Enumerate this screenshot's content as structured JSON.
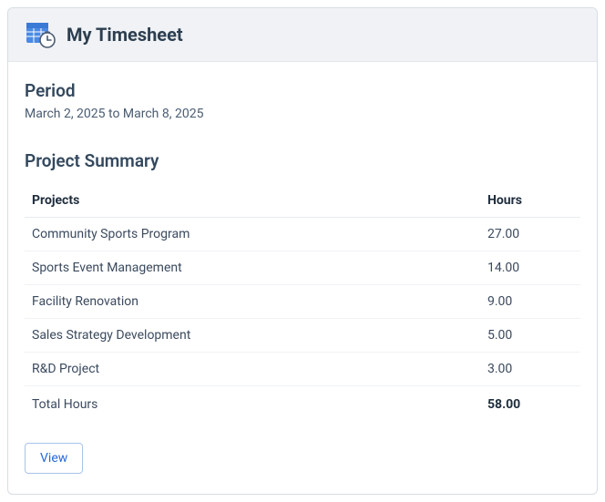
{
  "header": {
    "title": "My Timesheet"
  },
  "period": {
    "heading": "Period",
    "range": "March 2, 2025 to March 8, 2025"
  },
  "summary": {
    "heading": "Project Summary",
    "columns": {
      "project": "Projects",
      "hours": "Hours"
    },
    "rows": [
      {
        "project": "Community Sports Program",
        "hours": "27.00"
      },
      {
        "project": "Sports Event Management",
        "hours": "14.00"
      },
      {
        "project": "Facility Renovation",
        "hours": "9.00"
      },
      {
        "project": "Sales Strategy Development",
        "hours": "5.00"
      },
      {
        "project": "R&D Project",
        "hours": "3.00"
      }
    ],
    "total": {
      "label": "Total Hours",
      "hours": "58.00"
    }
  },
  "actions": {
    "view": "View"
  }
}
